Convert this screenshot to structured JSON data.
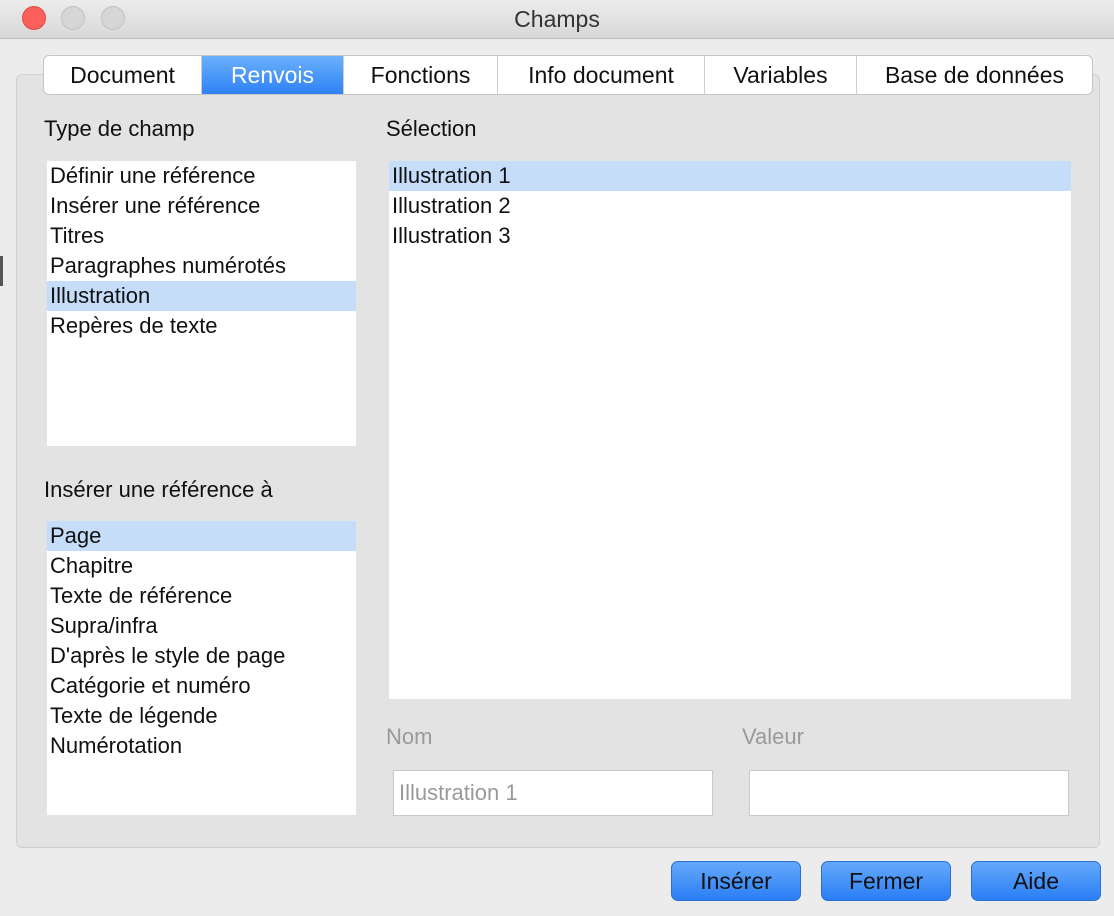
{
  "window": {
    "title": "Champs"
  },
  "tabs": [
    {
      "label": "Document"
    },
    {
      "label": "Renvois"
    },
    {
      "label": "Fonctions"
    },
    {
      "label": "Info document"
    },
    {
      "label": "Variables"
    },
    {
      "label": "Base de données"
    }
  ],
  "active_tab": "Renvois",
  "type_de_champ": {
    "label": "Type de champ",
    "items": [
      "Définir une référence",
      "Insérer une référence",
      "Titres",
      "Paragraphes numérotés",
      "Illustration",
      "Repères de texte"
    ],
    "selected": "Illustration"
  },
  "inserer_reference": {
    "label": "Insérer une référence à",
    "items": [
      "Page",
      "Chapitre",
      "Texte de référence",
      "Supra/infra",
      "D'après le style de page",
      "Catégorie et numéro",
      "Texte de légende",
      "Numérotation"
    ],
    "selected": "Page"
  },
  "selection": {
    "label": "Sélection",
    "items": [
      "Illustration 1",
      "Illustration 2",
      "Illustration 3"
    ],
    "selected": "Illustration 1"
  },
  "nom": {
    "label": "Nom",
    "value": "Illustration 1"
  },
  "valeur": {
    "label": "Valeur",
    "value": ""
  },
  "buttons": {
    "inserer": "Insérer",
    "fermer": "Fermer",
    "aide": "Aide"
  },
  "colors": {
    "accent": "#2f82f6",
    "selection_highlight": "#c6ddfa",
    "close_button": "#fc605b"
  }
}
